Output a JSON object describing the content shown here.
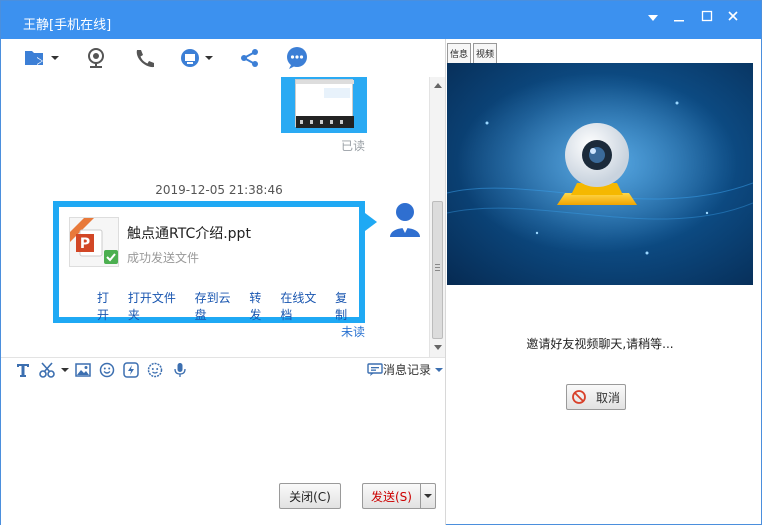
{
  "window": {
    "title": "王静[手机在线]",
    "controls": {
      "dropdown": "▾",
      "minimize": "—",
      "maximize": "☐",
      "close": "✕"
    }
  },
  "chat": {
    "read_label_1": "已读",
    "timestamp": "2019-12-05 21:38:46",
    "file": {
      "name": "触点通RTC介绍.ppt",
      "status": "成功发送文件",
      "actions": [
        "打开",
        "打开文件夹",
        "存到云盘",
        "转发",
        "在线文档",
        "复制"
      ]
    },
    "read_label_2": "未读"
  },
  "input_toolbar": {
    "history_label": "消息记录"
  },
  "buttons": {
    "close": "关闭(C)",
    "send": "发送(S)"
  },
  "right_panel": {
    "tabs": [
      "信息",
      "视频"
    ],
    "invite_text": "邀请好友视频聊天,请稍等...",
    "cancel": "取消"
  },
  "colors": {
    "titlebar": "#3c91ef",
    "bubble_border": "#1fa9f4",
    "link": "#1956b0",
    "unread": "#2b73d1"
  }
}
